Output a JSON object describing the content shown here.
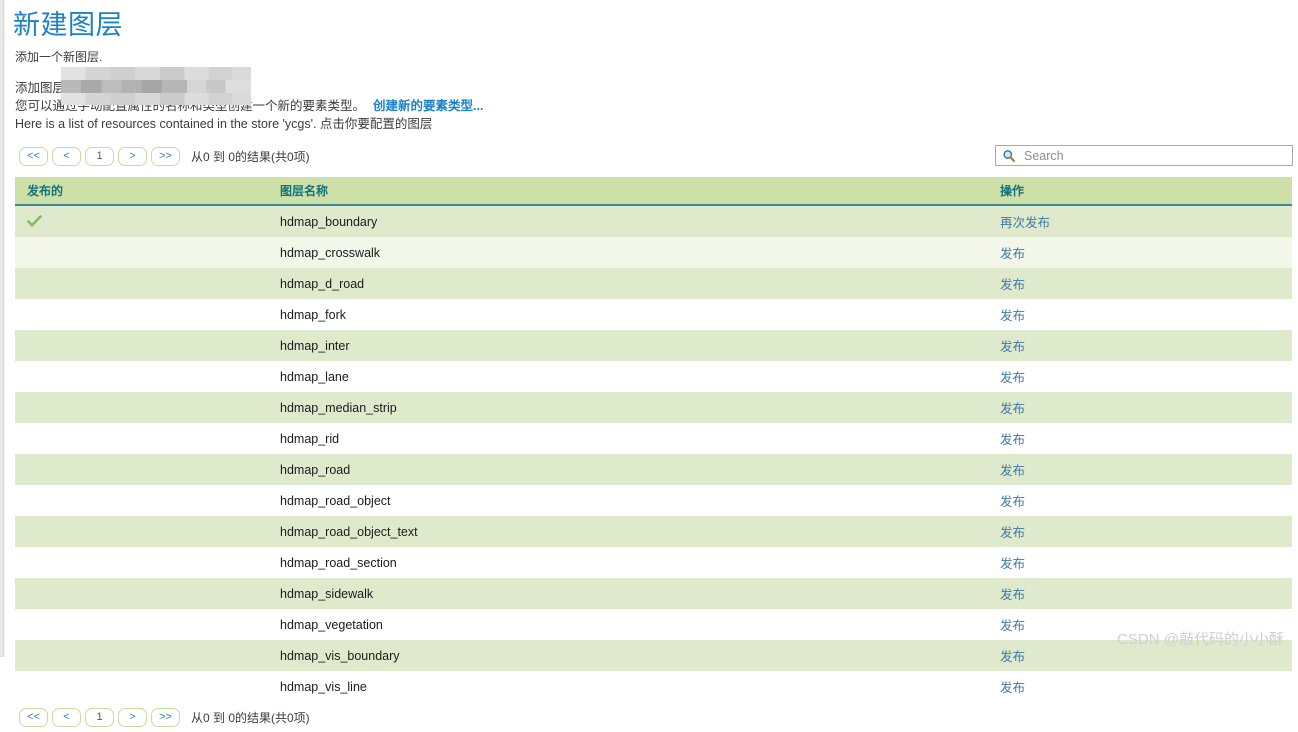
{
  "page": {
    "title": "新建图层",
    "subtitle": "添加一个新图层.",
    "desc_line1": "添加图层",
    "desc_line2": "您可以通过手动配置属性的名称和类型创建一个新的要素类型。",
    "desc_link": "创建新的要素类型...",
    "desc_line3": "Here is a list of resources contained in the store 'ycgs'. 点击你要配置的图层"
  },
  "pager": {
    "first": "<<",
    "prev": "<",
    "page": "1",
    "next": ">",
    "last": ">>",
    "status": "从0 到 0的结果(共0项)"
  },
  "search": {
    "placeholder": "Search",
    "value": "",
    "icon": "search-icon"
  },
  "table": {
    "columns": [
      "发布的",
      "图层名称",
      "操作"
    ],
    "rows": [
      {
        "published": true,
        "published_icon": "green-check-icon",
        "name": "hdmap_boundary",
        "action": "再次发布"
      },
      {
        "published": false,
        "published_icon": "",
        "name": "hdmap_crosswalk",
        "action": "发布"
      },
      {
        "published": false,
        "published_icon": "",
        "name": "hdmap_d_road",
        "action": "发布"
      },
      {
        "published": false,
        "published_icon": "",
        "name": "hdmap_fork",
        "action": "发布"
      },
      {
        "published": false,
        "published_icon": "",
        "name": "hdmap_inter",
        "action": "发布"
      },
      {
        "published": false,
        "published_icon": "",
        "name": "hdmap_lane",
        "action": "发布"
      },
      {
        "published": false,
        "published_icon": "",
        "name": "hdmap_median_strip",
        "action": "发布"
      },
      {
        "published": false,
        "published_icon": "",
        "name": "hdmap_rid",
        "action": "发布"
      },
      {
        "published": false,
        "published_icon": "",
        "name": "hdmap_road",
        "action": "发布"
      },
      {
        "published": false,
        "published_icon": "",
        "name": "hdmap_road_object",
        "action": "发布"
      },
      {
        "published": false,
        "published_icon": "",
        "name": "hdmap_road_object_text",
        "action": "发布"
      },
      {
        "published": false,
        "published_icon": "",
        "name": "hdmap_road_section",
        "action": "发布"
      },
      {
        "published": false,
        "published_icon": "",
        "name": "hdmap_sidewalk",
        "action": "发布"
      },
      {
        "published": false,
        "published_icon": "",
        "name": "hdmap_vegetation",
        "action": "发布"
      },
      {
        "published": false,
        "published_icon": "",
        "name": "hdmap_vis_boundary",
        "action": "发布"
      },
      {
        "published": false,
        "published_icon": "",
        "name": "hdmap_vis_line",
        "action": "发布"
      }
    ]
  },
  "watermark": "CSDN @敲代码的小小酥",
  "colors": {
    "title_blue": "#1c82c8",
    "link_blue": "#1c82c8",
    "header_green": "#cde0a7",
    "header_text_teal": "#13737c",
    "header_rule_teal": "#3b8c96",
    "row_green": "#dfeacd",
    "row_green_light": "#f3f7ea",
    "row_white": "#ffffff",
    "action_link": "#3f7aa8",
    "pager_border": "#c6dda0",
    "check_green": "#5aa83c",
    "watermark_gray": "#cfcfcf"
  }
}
